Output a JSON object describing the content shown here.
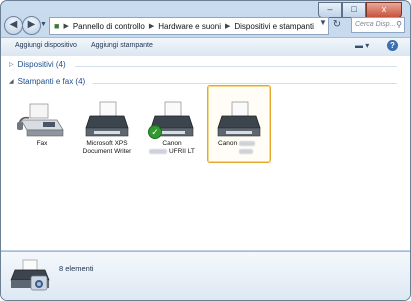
{
  "window": {
    "controls": {
      "minimize": "–",
      "maximize": "□",
      "close": "x"
    }
  },
  "address_bar": {
    "back_glyph": "◀",
    "forward_glyph": "▶",
    "breadcrumbs": [
      "Pannello di controllo",
      "Hardware e suoni",
      "Dispositivi e stampanti"
    ],
    "search_placeholder": "Cerca Disp..."
  },
  "toolbar": {
    "add_device_label": "Aggiungi dispositivo",
    "add_printer_label": "Aggiungi stampante"
  },
  "groups": {
    "devices": {
      "label": "Dispositivi (4)",
      "collapsed": true
    },
    "printers": {
      "label": "Stampanti e fax (4)",
      "collapsed": false
    }
  },
  "printers": [
    {
      "name_line1": "Fax",
      "name_line2": "",
      "icon": "fax-icon",
      "default": false,
      "selected": false
    },
    {
      "name_line1": "Microsoft XPS",
      "name_line2": "Document Writer",
      "icon": "printer-icon",
      "default": false,
      "selected": false
    },
    {
      "name_line1": "Canon",
      "name_line2": "UFRII LT",
      "icon": "printer-icon",
      "default": true,
      "selected": false
    },
    {
      "name_line1": "Canon",
      "name_line2": "",
      "icon": "printer-icon",
      "default": false,
      "selected": true
    }
  ],
  "details_pane": {
    "count_text": "8 elementi",
    "icon": "devices-printers-icon"
  },
  "colors": {
    "accent_blue": "#1e4e8c",
    "selection_border": "#e6a72a",
    "default_check": "#2f9a2f"
  }
}
